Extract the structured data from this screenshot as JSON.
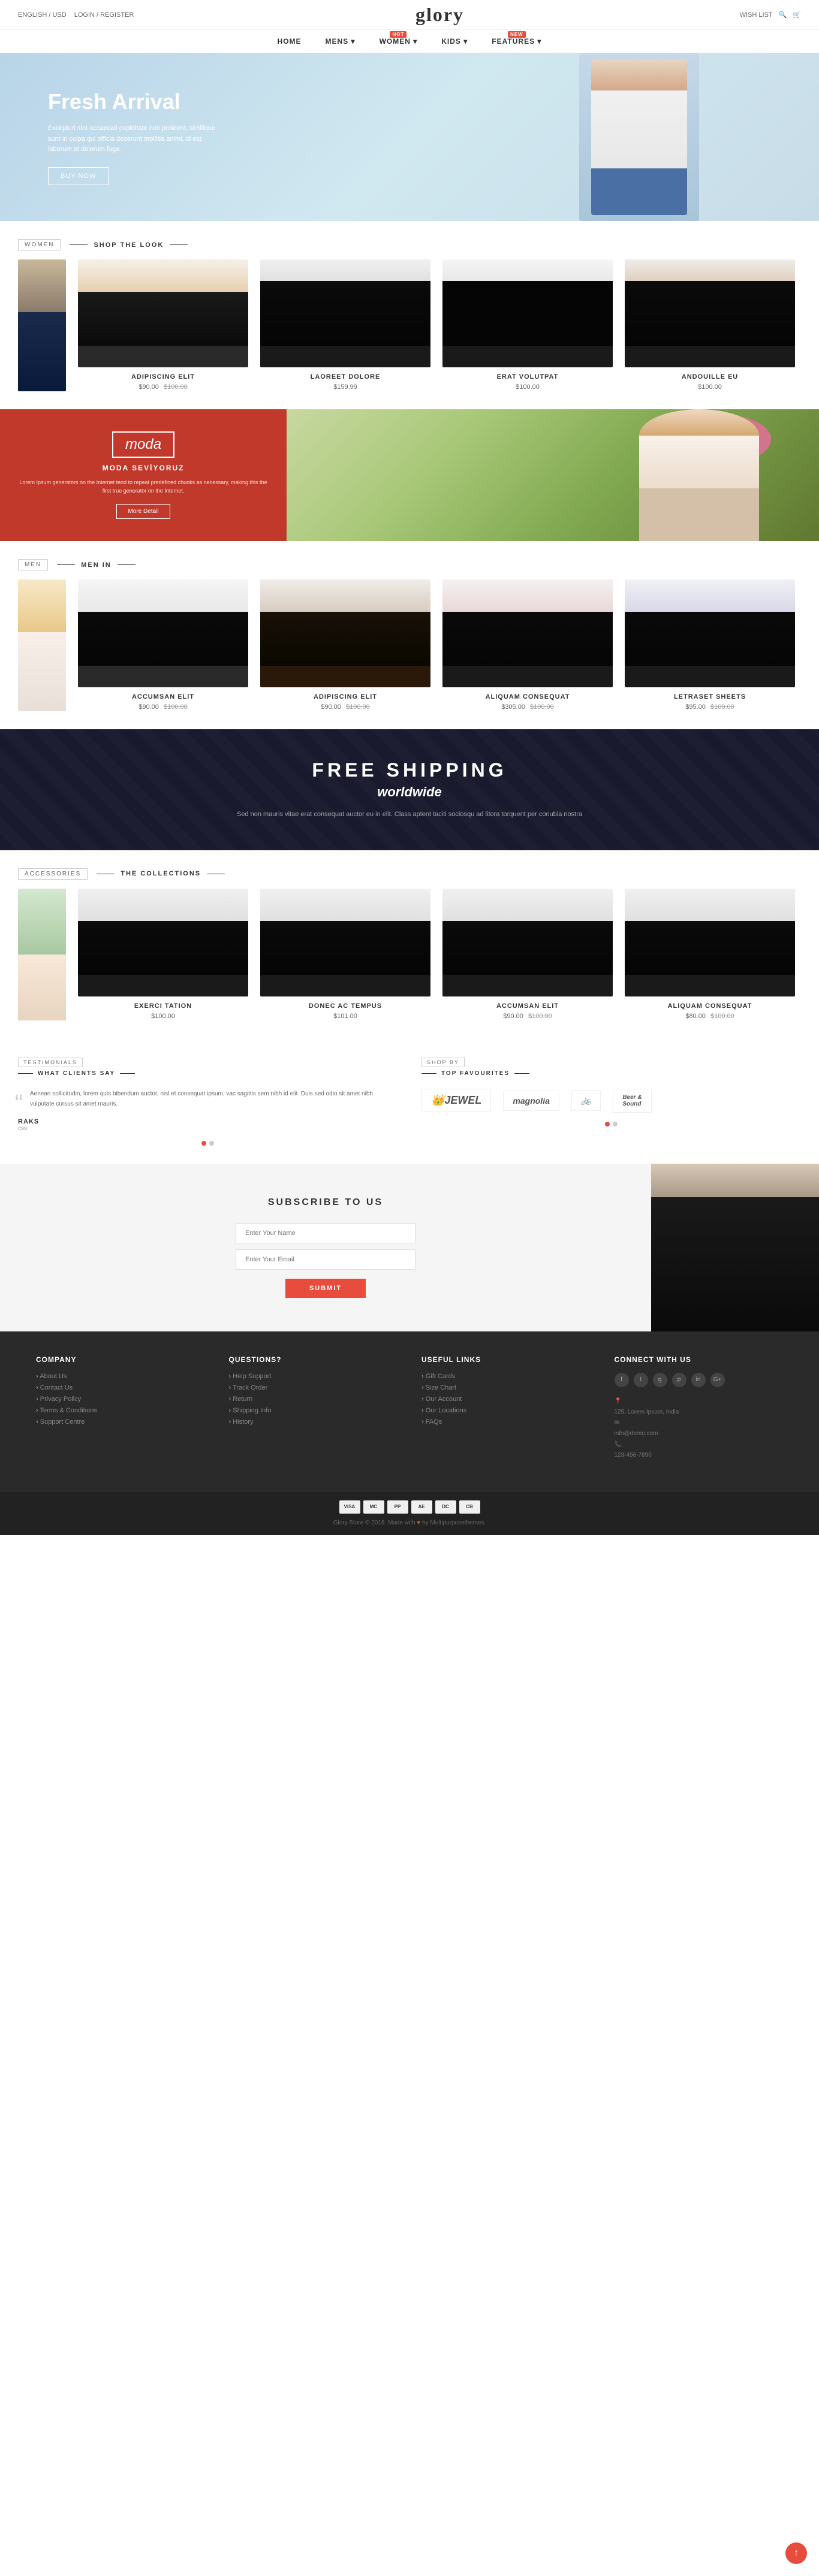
{
  "topbar": {
    "left": "ENGLISH / USD",
    "login": "LOGIN / REGISTER",
    "brand": "glory",
    "wishlist": "WISH LIST",
    "search_icon": "search",
    "cart_icon": "cart"
  },
  "nav": {
    "items": [
      {
        "label": "HOME",
        "badge": null
      },
      {
        "label": "MENS",
        "badge": null
      },
      {
        "label": "WOMEN",
        "badge": "HOT"
      },
      {
        "label": "KIDS",
        "badge": null
      },
      {
        "label": "FEATURES",
        "badge": "NEW"
      }
    ]
  },
  "hero": {
    "title": "Fresh Arrival",
    "desc": "Excepturi sint occaecati cupiditate non proident, similique sunt in culpa qui officia deserunt mollitia animi, id est laborum et dolorum fuga.",
    "btn": "BUY NOW"
  },
  "women_section": {
    "tag": "WOMEN",
    "subtitle": "SHOP THE LOOK",
    "products": [
      {
        "name": "ADIPISCING ELIT",
        "price": "$90.00",
        "old_price": "$100.00"
      },
      {
        "name": "LAOREET DOLORE",
        "price": "$159.99",
        "old_price": ""
      },
      {
        "name": "ERAT VOLUTPAT",
        "price": "$100.00",
        "old_price": ""
      },
      {
        "name": "ANDOUILLE EU",
        "price": "$100.00",
        "old_price": ""
      }
    ]
  },
  "moda": {
    "logo": "moda",
    "title": "MODA SEVİYORUZ",
    "desc": "Lorem Ipsum generators on the Internet tend to repeat predefined chunks as necessary, making this the first true generator on the Internet.",
    "btn": "More Detail"
  },
  "men_section": {
    "tag": "MEN",
    "subtitle": "MEN IN",
    "products": [
      {
        "name": "ACCUMSAN ELIT",
        "price": "$90.00",
        "old_price": "$100.00"
      },
      {
        "name": "ADIPISCING ELIT",
        "price": "$90.00",
        "old_price": "$100.00"
      },
      {
        "name": "ALIQUAM CONSEQUAT",
        "price": "$305.00",
        "old_price": "$100.00"
      },
      {
        "name": "LETRASET SHEETS",
        "price": "$95.00",
        "old_price": "$100.00"
      }
    ]
  },
  "free_shipping": {
    "title": "FREE SHIPPING",
    "subtitle": "worldwide",
    "desc": "Sed non mauris vitae erat consequat auctor eu in elit. Class aptent taciti sociosqu ad litora torquent per conubia nostra"
  },
  "accessories_section": {
    "tag": "ACCESSORIES",
    "subtitle": "THE COLLECTIONS",
    "products": [
      {
        "name": "EXERCI TATION",
        "price": "$100.00",
        "old_price": ""
      },
      {
        "name": "DONEC AC TEMPUS",
        "price": "$101.00",
        "old_price": ""
      },
      {
        "name": "ACCUMSAN ELIT",
        "price": "$90.00",
        "old_price": "$100.00"
      },
      {
        "name": "ALIQUAM CONSEQUAT",
        "price": "$80.00",
        "old_price": "$100.00"
      }
    ]
  },
  "testimonials": {
    "tag": "TESTIMONIALS",
    "subtitle": "WHAT CLIENTS SAY",
    "quote": "Aenean sollicitudin, lorem quis bibendum auctor, nisl et consequat ipsum, vac sagittis sem nibh id elit. Duis sed odio sit amet nibh vulputate cursus sit amet mauris.",
    "author": "RAKS",
    "role": "css"
  },
  "shop_by": {
    "tag": "SHOP BY",
    "subtitle": "TOP FAVOURITES",
    "brands": [
      {
        "name": "JEWEL",
        "style": "italic"
      },
      {
        "name": "magnolia",
        "style": "italic"
      },
      {
        "name": "🚲",
        "style": "normal"
      },
      {
        "name": "Beer & Sound",
        "style": "normal"
      }
    ]
  },
  "subscribe": {
    "title": "SUBSCRIBE TO US",
    "name_placeholder": "Enter Your Name",
    "email_placeholder": "Enter Your Email",
    "btn": "SUBMIT"
  },
  "footer": {
    "company": {
      "title": "Company",
      "links": [
        "About Us",
        "Contact Us",
        "Privacy Policy",
        "Terms & Conditions",
        "Support Centre"
      ]
    },
    "questions": {
      "title": "Questions?",
      "links": [
        "Help Support",
        "Track Order",
        "Return",
        "Shipping Info",
        "History"
      ]
    },
    "useful_links": {
      "title": "Useful Links",
      "links": [
        "Gift Cards",
        "Size Chart",
        "Our Account",
        "Our Locations",
        "FAQs"
      ]
    },
    "connect": {
      "title": "Connect With Us",
      "social": [
        "f",
        "t",
        "g",
        "p",
        "in",
        "G+"
      ],
      "address": "125, Lorem Ipsum, India",
      "email": "info@demo.com",
      "phone": "123-456-7890"
    }
  },
  "footer_bottom": {
    "copy": "Glory Store © 2018. Made with ♥ by Multipurposethemes.",
    "payment_icons": [
      "VISA",
      "MC",
      "PP",
      "AE",
      "DC",
      "CB"
    ]
  }
}
